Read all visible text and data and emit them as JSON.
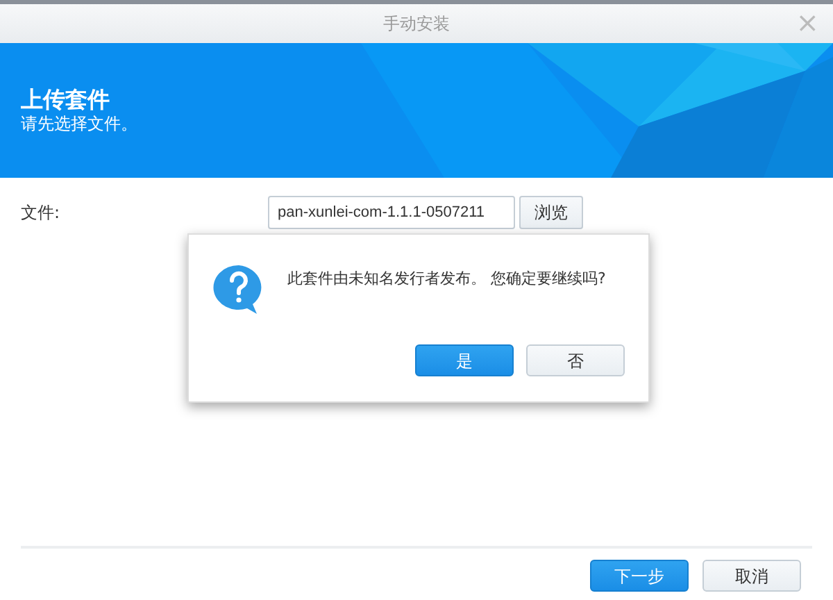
{
  "window": {
    "title": "手动安装",
    "close": "×"
  },
  "banner": {
    "title": "上传套件",
    "subtitle": "请先选择文件。"
  },
  "file_row": {
    "label": "文件:",
    "value": "pan-xunlei-com-1.1.1-0507211",
    "browse": "浏览"
  },
  "footer_buttons": [
    {
      "label": "下一步",
      "kind": "primary"
    },
    {
      "label": "取消",
      "kind": "secondary"
    }
  ],
  "dialog": {
    "message": "此套件由未知名发行者发布。 您确定要继续吗?",
    "buttons": [
      {
        "label": "是",
        "kind": "primary"
      },
      {
        "label": "否",
        "kind": "secondary"
      }
    ]
  }
}
